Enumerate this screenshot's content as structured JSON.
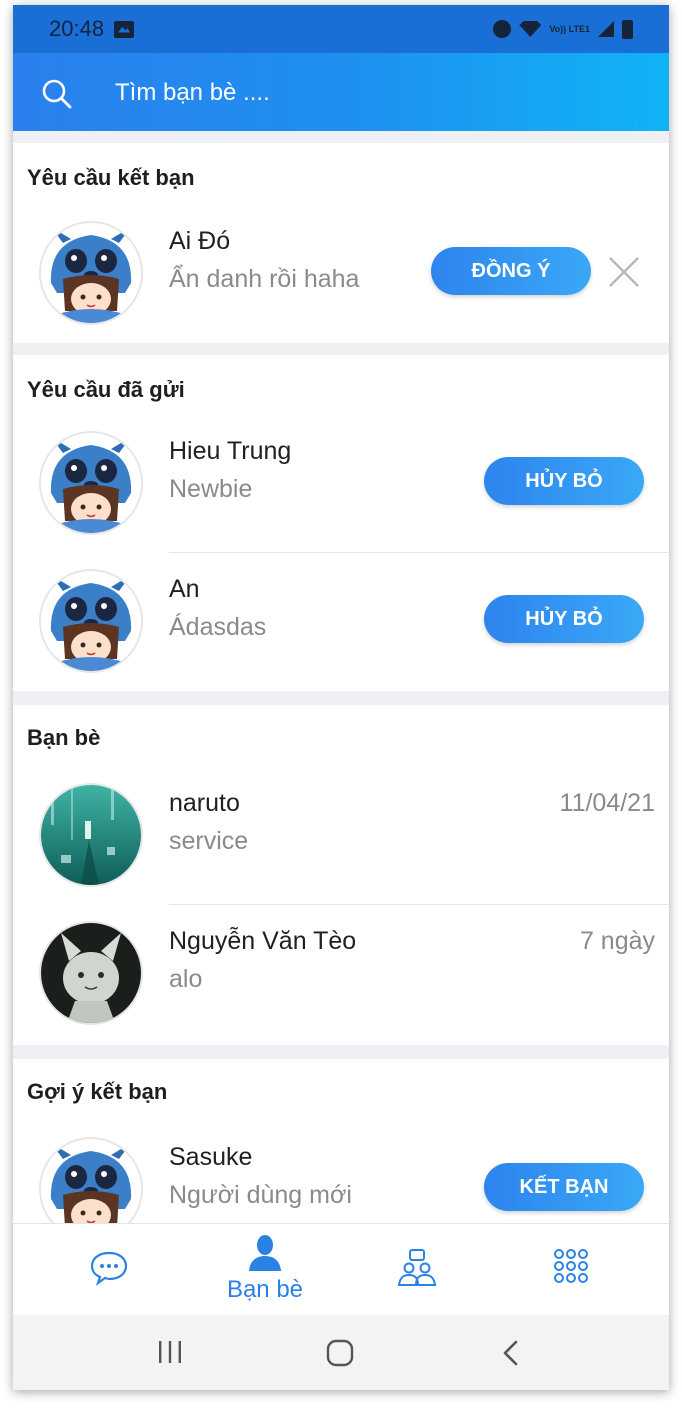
{
  "status_bar": {
    "time": "20:48",
    "network": "Vo)) LTE1"
  },
  "search": {
    "placeholder": "Tìm bạn bè ...."
  },
  "sections": {
    "requests": {
      "title": "Yêu cầu kết bạn",
      "items": [
        {
          "name": "Ai Đó",
          "status": "Ẩn danh rồi haha",
          "accept_label": "ĐỒNG Ý",
          "avatar": "stitch-hood-avatar"
        }
      ]
    },
    "sent": {
      "title": "Yêu cầu đã gửi",
      "items": [
        {
          "name": "Hieu Trung",
          "status": "Newbie",
          "action_label": "HỦY BỎ",
          "avatar": "stitch-hood-avatar"
        },
        {
          "name": "An",
          "status": "Ádasdas",
          "action_label": "HỦY BỎ",
          "avatar": "stitch-hood-avatar"
        }
      ]
    },
    "friends": {
      "title": "Bạn bè",
      "items": [
        {
          "name": "naruto",
          "status": "service",
          "time": "11/04/21",
          "avatar": "teal-landscape-avatar"
        },
        {
          "name": "Nguyễn Văn Tèo",
          "status": "alo",
          "time": "7 ngày",
          "avatar": "sketch-creature-avatar"
        }
      ]
    },
    "suggestions": {
      "title": "Gợi ý kết bạn",
      "items": [
        {
          "name": "Sasuke",
          "status": "Người dùng mới",
          "action_label": "KẾT BẠN",
          "avatar": "stitch-hood-avatar"
        }
      ]
    }
  },
  "bottom_nav": {
    "items": [
      {
        "icon": "chat-bubble-icon",
        "label": ""
      },
      {
        "icon": "person-icon",
        "label": "Bạn bè",
        "active": true
      },
      {
        "icon": "group-chat-icon",
        "label": ""
      },
      {
        "icon": "apps-grid-icon",
        "label": ""
      }
    ]
  },
  "colors": {
    "accent": "#2a82e4",
    "header_start": "#2a80ee",
    "header_end": "#10b3f6",
    "secondary_text": "#8a8a8a"
  }
}
